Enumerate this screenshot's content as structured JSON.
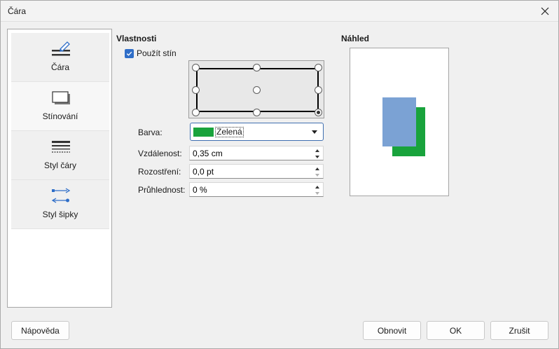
{
  "window": {
    "title": "Čára"
  },
  "sidebar": {
    "items": [
      {
        "label": "Čára",
        "icon": "line-pencil-icon"
      },
      {
        "label": "Stínování",
        "icon": "shadow-box-icon"
      },
      {
        "label": "Styl čáry",
        "icon": "line-style-icon"
      },
      {
        "label": "Styl šipky",
        "icon": "arrow-style-icon"
      }
    ]
  },
  "properties": {
    "title": "Vlastnosti",
    "use_shadow_label": "Použít stín",
    "use_shadow_checked": true,
    "color_label": "Barva:",
    "color_value": "Zelená",
    "color_hex": "#19a33c",
    "distance_label": "Vzdálenost:",
    "distance_value": "0,35 cm",
    "blur_label": "Rozostření:",
    "blur_value": "0,0 pt",
    "transparency_label": "Průhlednost:",
    "transparency_value": "0 %"
  },
  "preview": {
    "title": "Náhled",
    "object_color": "#7ba2d4",
    "shadow_color": "#19a33c"
  },
  "buttons": {
    "help": "Nápověda",
    "reset": "Obnovit",
    "ok": "OK",
    "cancel": "Zrušit"
  }
}
